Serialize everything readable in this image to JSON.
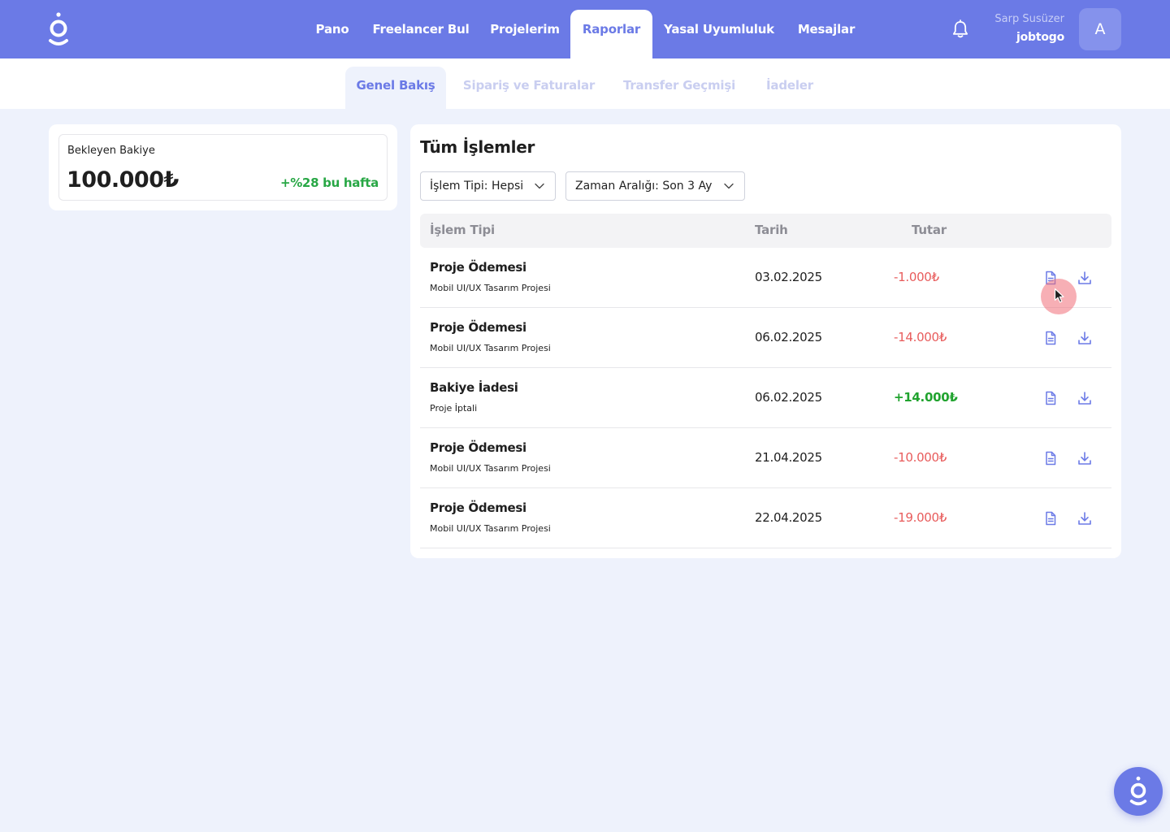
{
  "nav": {
    "items": [
      {
        "label": "Pano"
      },
      {
        "label": "Freelancer Bul"
      },
      {
        "label": "Projelerim"
      },
      {
        "label": "Raporlar",
        "active": true
      },
      {
        "label": "Yasal Uyumluluk"
      },
      {
        "label": "Mesajlar"
      }
    ],
    "notification_icon": "bell-icon"
  },
  "user": {
    "name": "Sarp Susüzer",
    "company": "jobtogo",
    "avatar_letter": "A"
  },
  "subtabs": [
    {
      "label": "Genel Bakış",
      "active": true
    },
    {
      "label": "Sipariş ve Faturalar"
    },
    {
      "label": "Transfer Geçmişi"
    },
    {
      "label": "İadeler"
    }
  ],
  "balance": {
    "label": "Bekleyen Bakiye",
    "value": "100.000₺",
    "change": "+%28 bu hafta"
  },
  "transactions": {
    "title": "Tüm İşlemler",
    "filters": {
      "type": "İşlem Tipi: Hepsi",
      "range": "Zaman Aralığı: Son 3 Ay"
    },
    "columns": [
      "İşlem Tipi",
      "Tarih",
      "Tutar"
    ],
    "rows": [
      {
        "title": "Proje Ödemesi",
        "subtitle": "Mobil UI/UX Tasarım Projesi",
        "date": "03.02.2025",
        "amount": "-1.000₺"
      },
      {
        "title": "Proje Ödemesi",
        "subtitle": "Mobil UI/UX Tasarım Projesi",
        "date": "06.02.2025",
        "amount": "-14.000₺"
      },
      {
        "title": "Bakiye İadesi",
        "subtitle": "Proje İptali",
        "date": "06.02.2025",
        "amount": "+14.000₺"
      },
      {
        "title": "Proje Ödemesi",
        "subtitle": "Mobil UI/UX Tasarım Projesi",
        "date": "21.04.2025",
        "amount": "-10.000₺"
      },
      {
        "title": "Proje Ödemesi",
        "subtitle": "Mobil UI/UX Tasarım Projesi",
        "date": "22.04.2025",
        "amount": "-19.000₺"
      }
    ],
    "row_icons": [
      "document-icon",
      "download-icon"
    ]
  },
  "colors": {
    "brand": "#6b7ae6",
    "negative": "#e85c5c",
    "positive": "#21a32f",
    "background": "#eef2fc"
  }
}
